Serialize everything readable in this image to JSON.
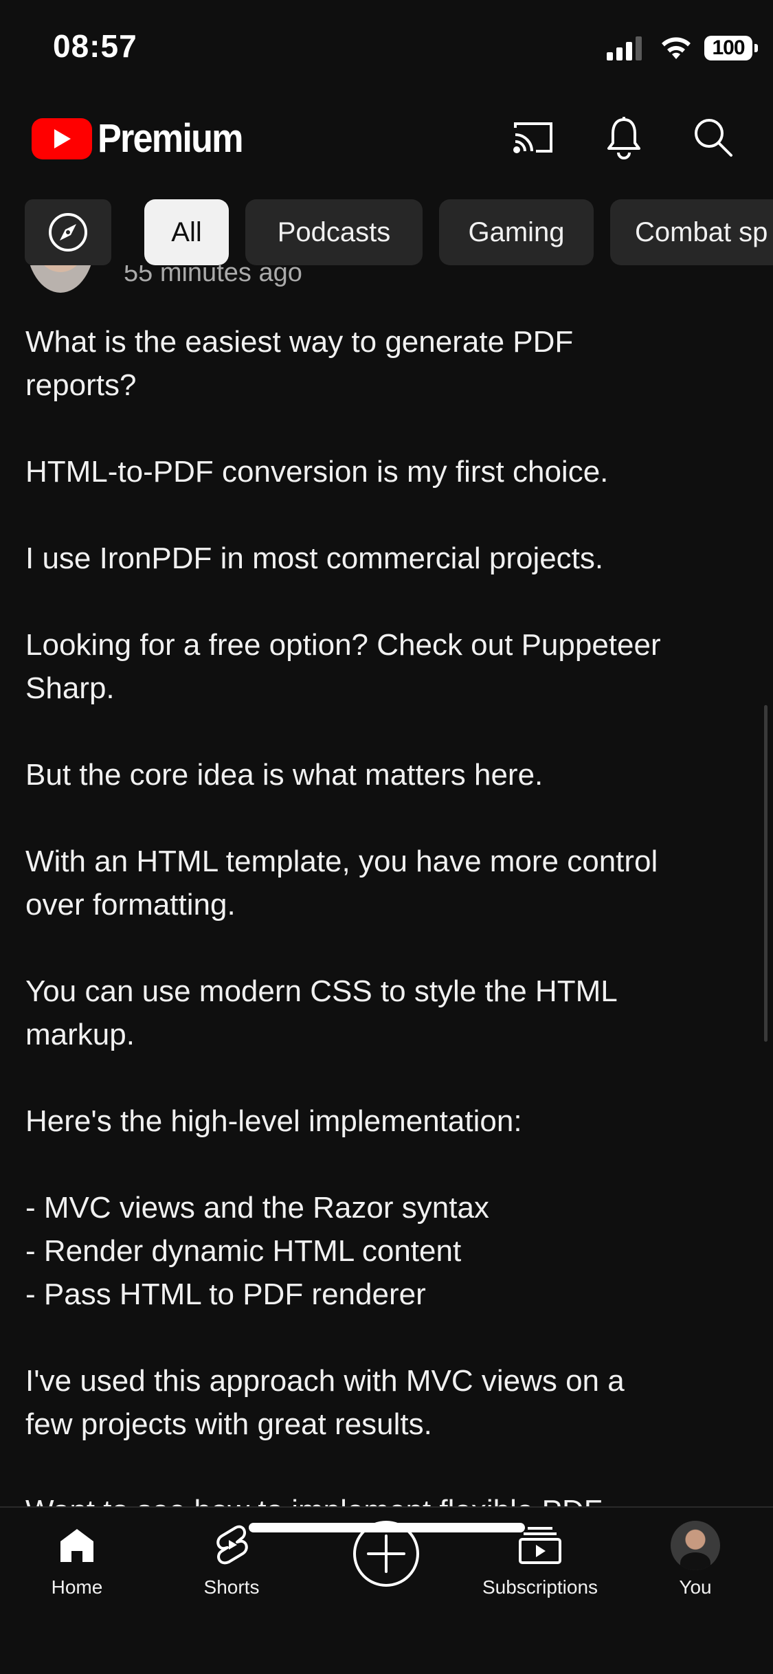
{
  "status_bar": {
    "time": "08:57",
    "battery": "100",
    "icons": [
      "cellular-signal-icon",
      "wifi-icon",
      "battery-icon"
    ]
  },
  "app_bar": {
    "logo_text": "Premium",
    "brand_color": "#ff0000",
    "actions": [
      "cast-icon",
      "notifications-bell-icon",
      "search-icon"
    ]
  },
  "chips": {
    "explore_icon": "compass-icon",
    "items": [
      {
        "label": "All",
        "selected": true
      },
      {
        "label": "Podcasts",
        "selected": false
      },
      {
        "label": "Gaming",
        "selected": false
      },
      {
        "label": "Combat sp",
        "selected": false
      }
    ]
  },
  "post": {
    "time": "55 minutes ago",
    "text": "What is the easiest way to generate PDF\nreports?\n\nHTML-to-PDF conversion is my first choice.\n\nI use IronPDF in most commercial projects.\n\nLooking for a free option? Check out Puppeteer\nSharp.\n\nBut the core idea is what matters here.\n\nWith an HTML template, you have more control\nover formatting.\n\nYou can use modern CSS to style the HTML\nmarkup.\n\nHere's the high-level implementation:\n\n- MVC views and the Razor syntax\n- Render dynamic HTML content\n- Pass HTML to PDF renderer\n\nI've used this approach with MVC views on a\nfew projects with great results.\n\nWant to see how to implement flexible PDF"
  },
  "bottom_nav": {
    "home": "Home",
    "shorts": "Shorts",
    "create_icon": "create-plus-icon",
    "subscriptions": "Subscriptions",
    "you": "You"
  },
  "colors": {
    "background": "#0f0f0f",
    "chip_background": "#272727",
    "chip_selected_background": "#f1f1f1",
    "text_primary": "#f1f1f1",
    "text_secondary": "#aaaaaa"
  }
}
